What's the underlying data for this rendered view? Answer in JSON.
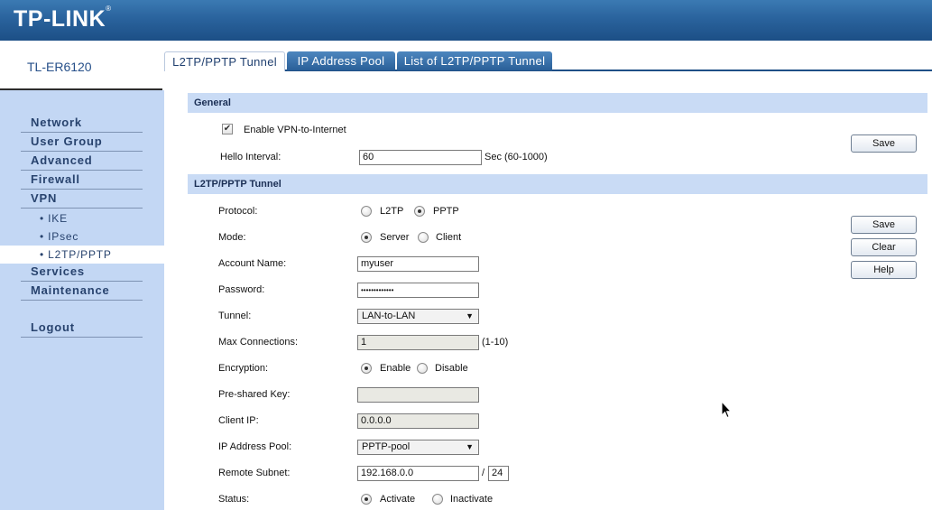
{
  "header": {
    "brand": "TP-LINK",
    "brand_mark": "®"
  },
  "device": {
    "model": "TL-ER6120"
  },
  "menu": {
    "items": [
      {
        "label": "Network"
      },
      {
        "label": "User Group"
      },
      {
        "label": "Advanced"
      },
      {
        "label": "Firewall"
      },
      {
        "label": "VPN"
      },
      {
        "label": "Services"
      },
      {
        "label": "Maintenance"
      },
      {
        "label": "Logout"
      }
    ],
    "vpn_sub": [
      {
        "label": "• IKE"
      },
      {
        "label": "• IPsec"
      },
      {
        "label": "• L2TP/PPTP"
      }
    ]
  },
  "tabs": [
    {
      "label": "L2TP/PPTP Tunnel",
      "active": true
    },
    {
      "label": "IP Address Pool",
      "active": false
    },
    {
      "label": "List of L2TP/PPTP Tunnel",
      "active": false
    }
  ],
  "general": {
    "title": "General",
    "enable_vpn_label": "Enable VPN-to-Internet",
    "enable_vpn_checked": true,
    "hello_label": "Hello Interval:",
    "hello_value": "60",
    "hello_hint": "Sec (60-1000)",
    "save_label": "Save"
  },
  "tunnel": {
    "title": "L2TP/PPTP Tunnel",
    "protocol_label": "Protocol:",
    "protocol_opt1": "L2TP",
    "protocol_opt2": "PPTP",
    "mode_label": "Mode:",
    "mode_opt1": "Server",
    "mode_opt2": "Client",
    "account_label": "Account Name:",
    "account_value": "myuser",
    "password_label": "Password:",
    "password_value": "•••••••••••••",
    "tunnel_label": "Tunnel:",
    "tunnel_value": "LAN-to-LAN",
    "maxconn_label": "Max Connections:",
    "maxconn_value": "1",
    "maxconn_hint": "(1-10)",
    "encryption_label": "Encryption:",
    "encryption_opt1": "Enable",
    "encryption_opt2": "Disable",
    "psk_label": "Pre-shared Key:",
    "psk_value": "",
    "clientip_label": "Client IP:",
    "clientip_value": "0.0.0.0",
    "pool_label": "IP Address Pool:",
    "pool_value": "PPTP-pool",
    "subnet_label": "Remote Subnet:",
    "subnet_value": "192.168.0.0",
    "subnet_sep": "/",
    "subnet_mask": "24",
    "status_label": "Status:",
    "status_opt1": "Activate",
    "status_opt2": "Inactivate",
    "save_label": "Save",
    "clear_label": "Clear",
    "help_label": "Help"
  }
}
